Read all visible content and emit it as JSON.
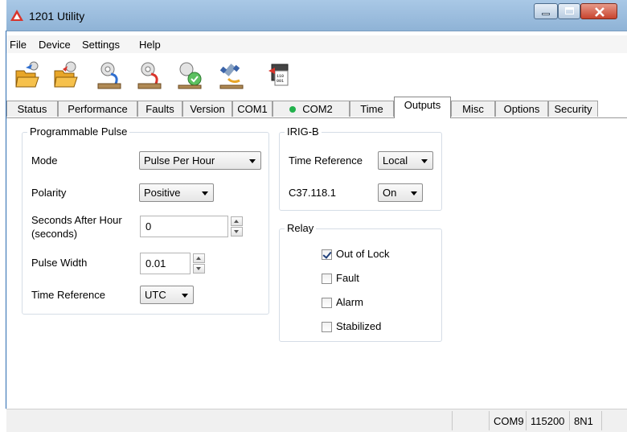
{
  "window": {
    "title": "1201 Utility"
  },
  "menu": [
    "File",
    "Device",
    "Settings",
    "Help"
  ],
  "toolbar": {
    "icons": [
      "open-folder-icon",
      "open-folder-settings-icon",
      "download-settings-icon",
      "upload-settings-icon",
      "verify-settings-icon",
      "satellite-icon",
      "firmware-chip-icon"
    ]
  },
  "tabs": [
    {
      "label": "Status"
    },
    {
      "label": "Performance"
    },
    {
      "label": "Faults"
    },
    {
      "label": "Version"
    },
    {
      "label": "COM1"
    },
    {
      "label": "COM2",
      "status_dot": "#22b14c"
    },
    {
      "label": "Time"
    },
    {
      "label": "Outputs",
      "active": true
    },
    {
      "label": "Misc"
    },
    {
      "label": "Options"
    },
    {
      "label": "Security"
    }
  ],
  "programmable_pulse": {
    "title": "Programmable Pulse",
    "mode_label": "Mode",
    "mode_value": "Pulse Per Hour",
    "polarity_label": "Polarity",
    "polarity_value": "Positive",
    "seconds_label_1": "Seconds After Hour",
    "seconds_label_2": "(seconds)",
    "seconds_value": "0",
    "pulse_width_label": "Pulse Width",
    "pulse_width_value": "0.01",
    "time_ref_label": "Time Reference",
    "time_ref_value": "UTC"
  },
  "irig_b": {
    "title": "IRIG-B",
    "time_ref_label": "Time Reference",
    "time_ref_value": "Local",
    "c37_label": "C37.118.1",
    "c37_value": "On"
  },
  "relay": {
    "title": "Relay",
    "items": [
      {
        "label": "Out of Lock",
        "checked": true
      },
      {
        "label": "Fault",
        "checked": false
      },
      {
        "label": "Alarm",
        "checked": false
      },
      {
        "label": "Stabilized",
        "checked": false
      }
    ]
  },
  "statusbar": {
    "port": "COM9",
    "baud": "115200",
    "format": "8N1"
  }
}
